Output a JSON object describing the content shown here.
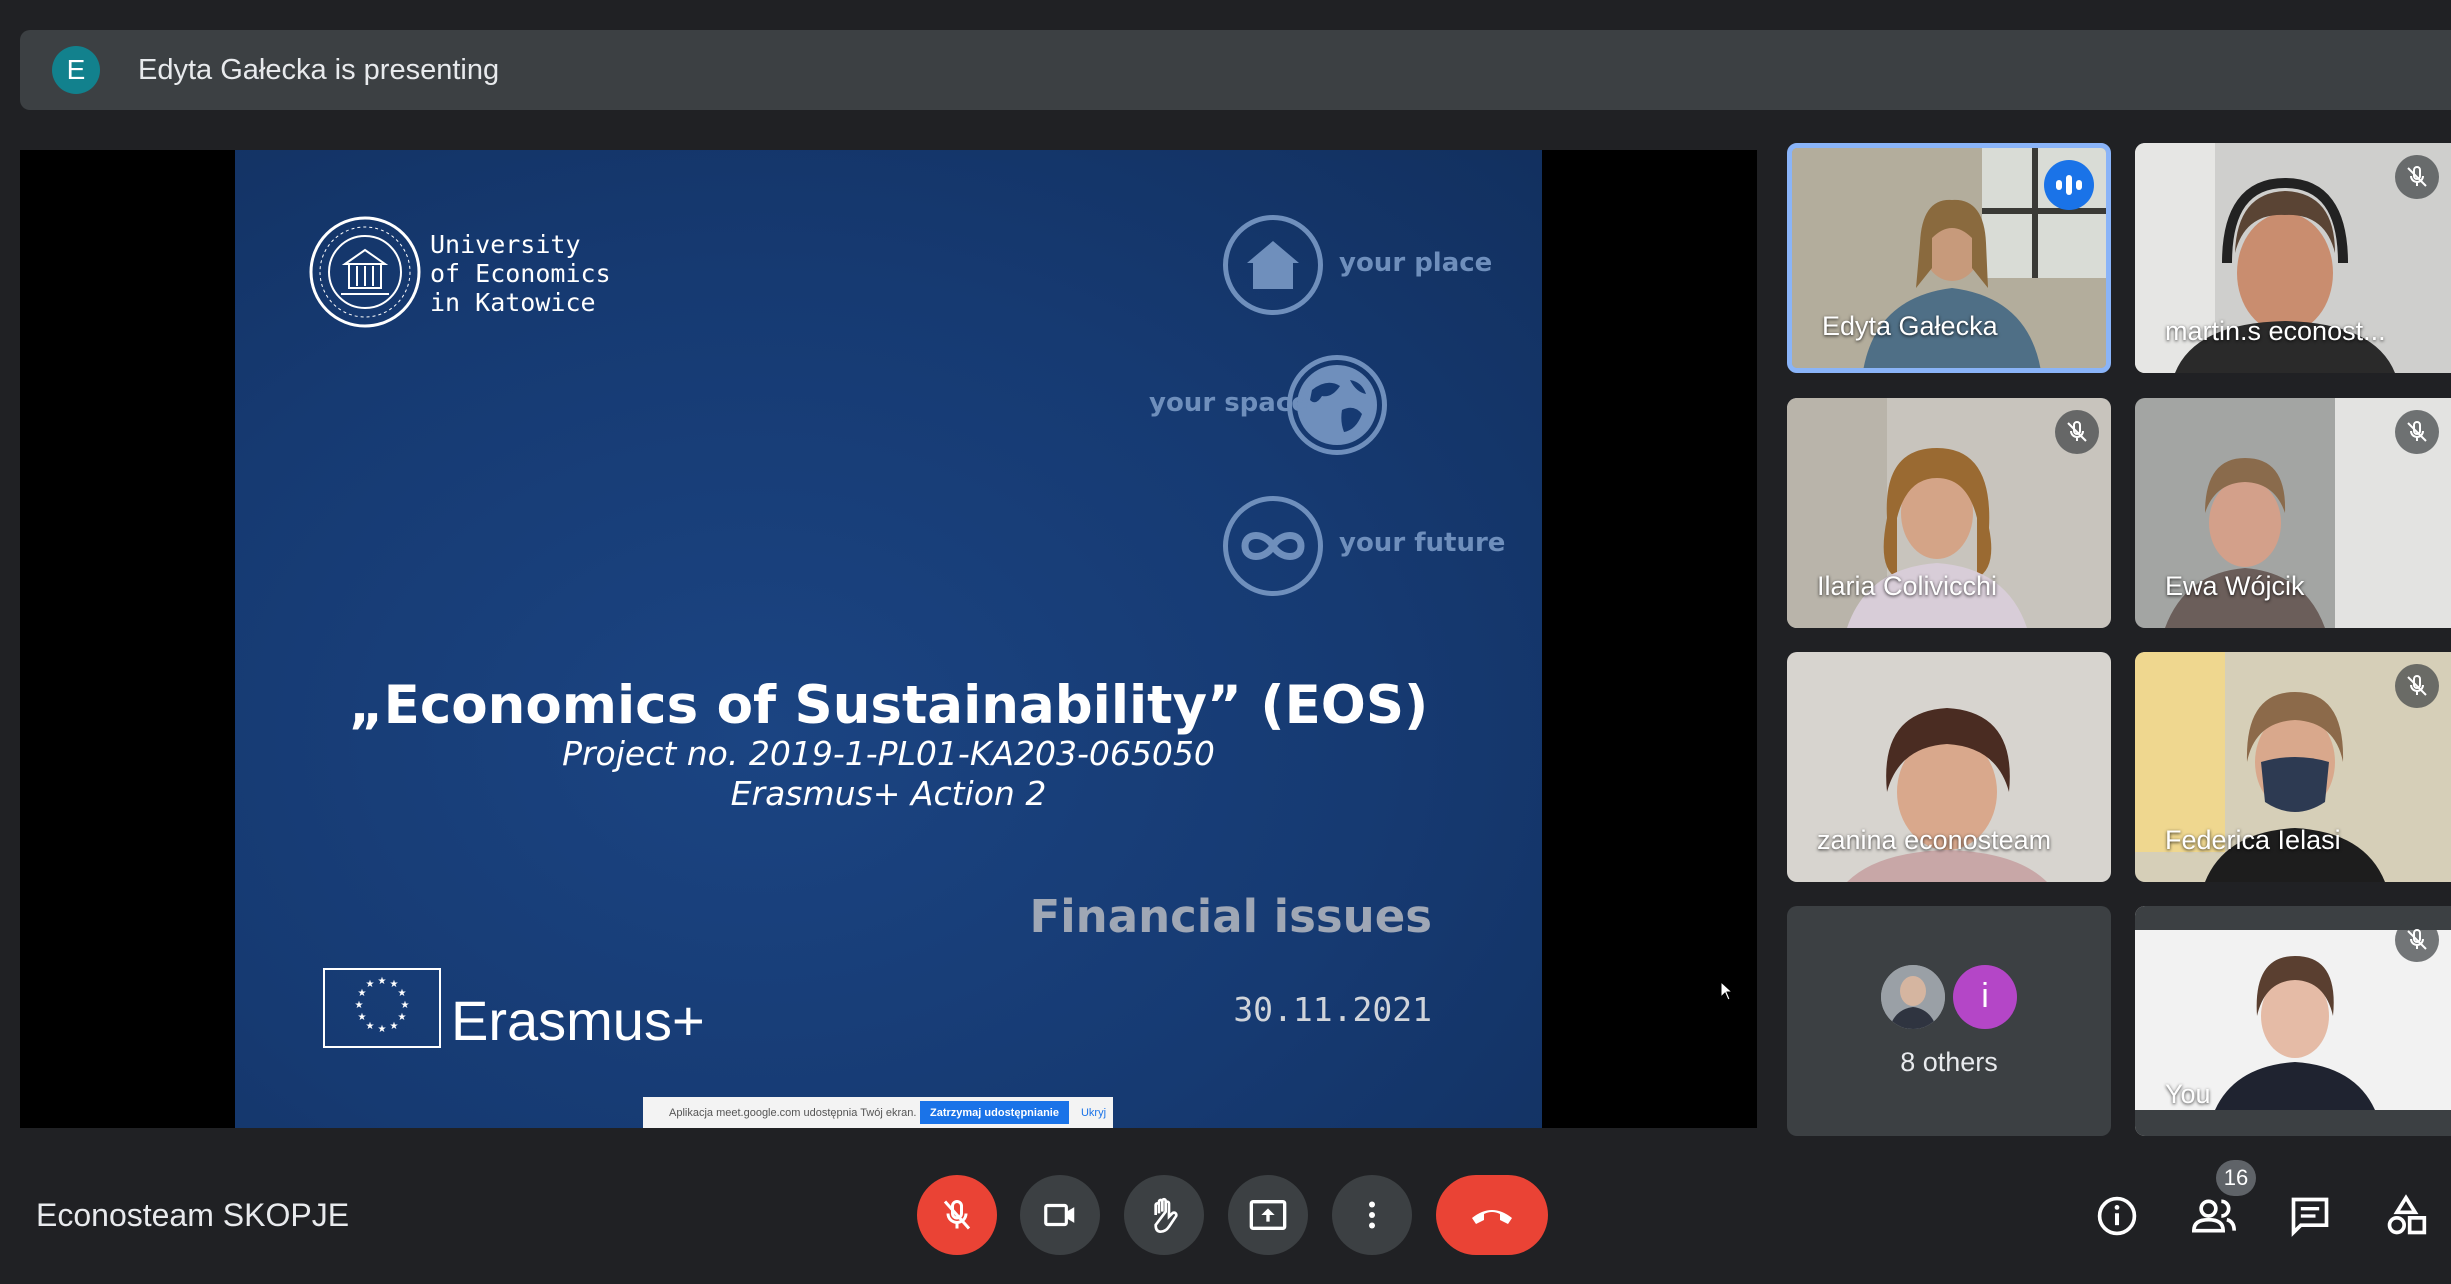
{
  "banner": {
    "avatar_letter": "E",
    "text": "Edyta Gałecka is presenting"
  },
  "slide": {
    "university": [
      "University",
      "of Economics",
      "in Katowice"
    ],
    "motto": {
      "place": "your place",
      "space": "your space",
      "future": "your future"
    },
    "title": "„Economics of Sustainability” (EOS)",
    "project": "Project no. 2019-1-PL01-KA203-065050",
    "action": "Erasmus+ Action 2",
    "section": "Financial issues",
    "date": "30.11.2021",
    "brand": "Erasmus+"
  },
  "share_bar": {
    "message": "Aplikacja meet.google.com udostępnia Twój ekran.",
    "stop_label": "Zatrzymaj udostępnianie",
    "hide_label": "Ukryj"
  },
  "participants": [
    {
      "name": "Edyta Gałecka",
      "speaking": true
    },
    {
      "name": "martin.s econost...",
      "muted": true
    },
    {
      "name": "Ilaria Colivicchi",
      "muted": true
    },
    {
      "name": "Ewa Wójcik",
      "muted": true
    },
    {
      "name": "zanina econosteam",
      "muted": false
    },
    {
      "name": "Federica Ielasi",
      "muted": true
    },
    {
      "name": "You",
      "muted": true
    }
  ],
  "others": {
    "avatar_letter": "i",
    "label": "8 others"
  },
  "meeting": {
    "name": "Econosteam SKOPJE"
  },
  "people_count": "16",
  "colors": {
    "background": "#202124",
    "tile": "#3c4043",
    "danger": "#ea4335",
    "accent": "#1a73e8",
    "slide": "#163a72"
  },
  "icons": [
    "mic-off-icon",
    "camera-icon",
    "raise-hand-icon",
    "present-icon",
    "more-icon",
    "end-call-icon",
    "info-icon",
    "people-icon",
    "chat-icon",
    "activities-icon"
  ]
}
